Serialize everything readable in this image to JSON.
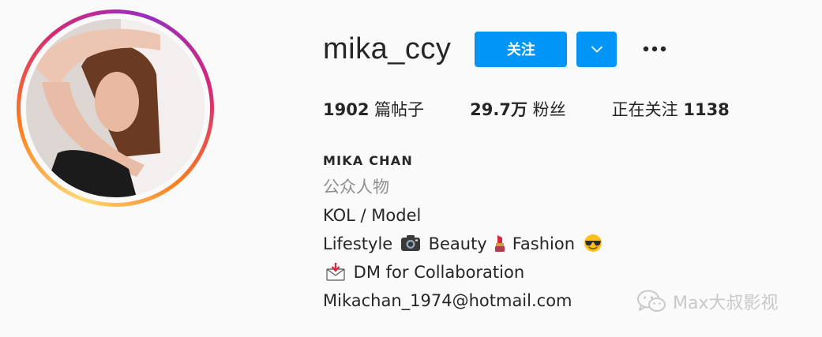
{
  "profile": {
    "username": "mika_ccy",
    "follow_label": "关注",
    "dropdown_icon": "chevron-down-icon",
    "more_icon": "more-options-icon"
  },
  "stats": {
    "posts_count": "1902",
    "posts_label": " 篇帖子",
    "followers_count": "29.7万",
    "followers_label": " 粉丝",
    "following_label": "正在关注 ",
    "following_count": "1138"
  },
  "bio": {
    "full_name": "MIKA CHAN",
    "category": "公众人物",
    "line1": "KOL / Model",
    "line2_a": "Lifestyle ",
    "line2_b": " Beauty",
    "line2_c": "Fashion ",
    "line3": " DM for Collaboration",
    "email": "Mikachan_1974@hotmail.com"
  },
  "watermark": {
    "text": "Max大叔影视"
  },
  "colors": {
    "follow_button": "#0095f6",
    "text": "#262626",
    "category": "#8e8e8e",
    "background": "#fafafa"
  }
}
